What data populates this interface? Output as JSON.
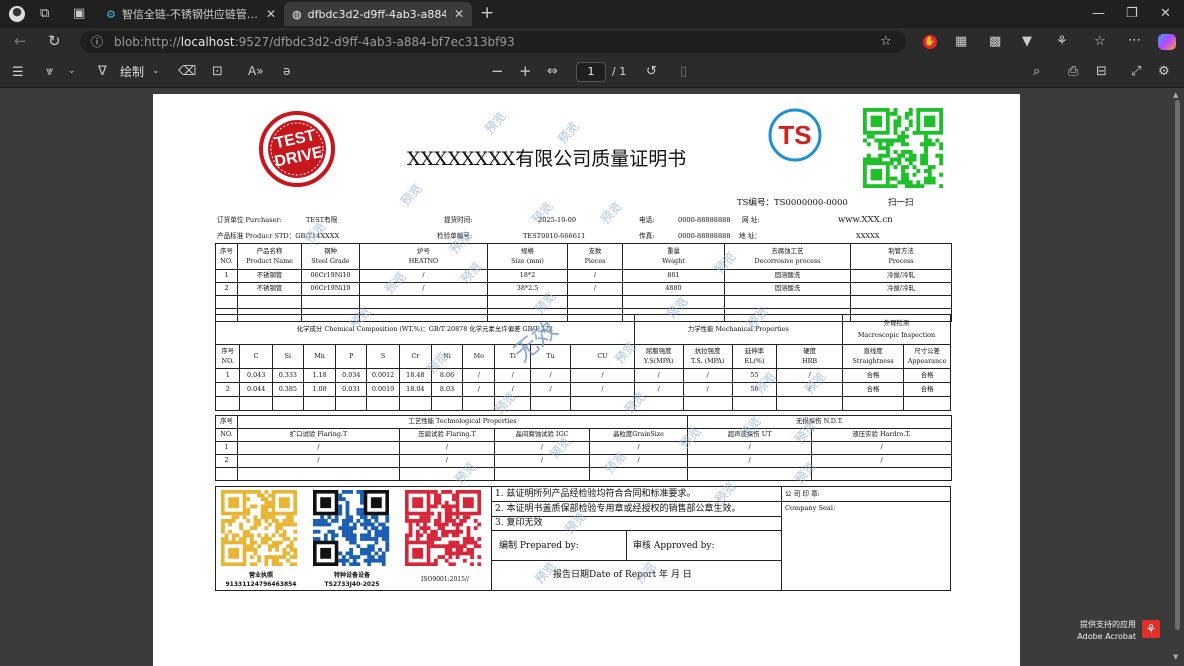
{
  "browser": {
    "tabs": [
      {
        "title": "智信全链-不锈钢供应链管理系统"
      },
      {
        "title": "dfbdc3d2-d9ff-4ab3-a884-bf7ec313bf93"
      }
    ],
    "url_prefix": "blob:http://",
    "url_host": "localhost",
    "url_rest": ":9527/dfbdc3d2-d9ff-4ab3-a884-bf7ec313bf93"
  },
  "pdf_toolbar": {
    "draw_label": "绘制",
    "page_current": "1",
    "page_total": "/ 1",
    "zoom_minus": "−",
    "zoom_plus": "+"
  },
  "acrobat": {
    "line1": "提供支持的应用",
    "line2": "Adobe Acrobat"
  },
  "certificate": {
    "stamp_text_1": "TEST",
    "stamp_text_2": "DRIVE",
    "ts_logo": "TS",
    "title": "XXXXXXXX有限公司质量证明书",
    "ts_no": "TS编号：TS0000000-0000",
    "scan": "扫一扫",
    "row1": {
      "buyer": "订货单位 Purchaser:",
      "buyer_val": "TEST有限",
      "ship": "提货时间:",
      "ship_val": "2025-10-09",
      "tel": "电话:",
      "tel_val": "0000-88888888",
      "web": "网  址:",
      "web_val": "www.XXX.cn"
    },
    "row2": {
      "std": "产品标准 Producr STD：GB/T14XXXX",
      "cert": "检验单编号:",
      "cert_val": "TEST0010-666611",
      "fax": "传真:",
      "fax_val": "0000-88888888",
      "addr": "地  址：",
      "addr_val": "XXXXX"
    },
    "main_head": [
      [
        "序号",
        "NO."
      ],
      [
        "产品名称",
        "Product Name"
      ],
      [
        "钢种",
        "Steel Grade"
      ],
      [
        "炉号",
        "HEATNO"
      ],
      [
        "规格",
        "Size (mm)"
      ],
      [
        "支数",
        "Pieces"
      ],
      [
        "重量",
        "Weight"
      ],
      [
        "去腐蚀工艺",
        "Decorrosive process"
      ],
      [
        "制管方法",
        "Process"
      ]
    ],
    "main_rows": [
      [
        "1",
        "不锈钢管",
        "06Cr19Ni10",
        "/",
        "18*2",
        "/",
        "801",
        "固溶酸洗",
        "冷拔/冷轧"
      ],
      [
        "2",
        "不锈钢管",
        "06Cr19Ni10",
        "/",
        "38*2.5",
        "/",
        "4880",
        "固溶酸洗",
        "冷拔/冷轧"
      ]
    ],
    "chem_title": "化学成分 Chemical Composition (WT.%)：GB/T 20878   化学元素允许偏差 GB/T 222",
    "mech_title": "力学性能 Mechanical Properties",
    "macro_title": "外观检测",
    "macro_sub": "Macroscopic Inspection",
    "chem_head": [
      [
        "序号",
        "NO."
      ],
      [
        "C",
        ""
      ],
      [
        "Si",
        ""
      ],
      [
        "Mn",
        ""
      ],
      [
        "P",
        ""
      ],
      [
        "S",
        ""
      ],
      [
        "Cr",
        ""
      ],
      [
        "Ni",
        ""
      ],
      [
        "Mo",
        ""
      ],
      [
        "Ti",
        ""
      ],
      [
        "Tu",
        ""
      ],
      [
        "CU",
        ""
      ],
      [
        "屈服强度",
        "Y.S(MPA)"
      ],
      [
        "抗拉强度",
        "T.S. (MPA)"
      ],
      [
        "延伸率",
        "EL(%)"
      ],
      [
        "硬度",
        "HRB"
      ],
      [
        "直线度",
        "Straightness"
      ],
      [
        "尺寸公差",
        "Appearance"
      ]
    ],
    "chem_rows": [
      [
        "1",
        "0.043",
        "0.333",
        "1.18",
        "0.034",
        "0.0012",
        "18.48",
        "8.06",
        "/",
        "/",
        "/",
        "/",
        "/",
        "/",
        "55",
        "/",
        "合格",
        "合格"
      ],
      [
        "2",
        "0.044",
        "0.385",
        "1.08",
        "0.031",
        "0.0019",
        "18.04",
        "8.03",
        "/",
        "/",
        "/",
        "/",
        "/",
        "/",
        "50",
        "/",
        "合格",
        "合格"
      ]
    ],
    "tech_no": "序号",
    "tech_title": "工艺性能 Technological Properties",
    "ndt_title": "无损探伤 N.D.T.",
    "tech_head": [
      "NO.",
      "扩口试验 Flaring.T",
      "压扁试验 Flaring.T",
      "晶间腐蚀试验 IGC",
      "晶粒度GrainSize",
      "超声波探伤 UT",
      "液压实验 Hardro.T."
    ],
    "tech_rows": [
      [
        "1",
        "/",
        "/",
        "/",
        "/",
        "/",
        "/"
      ],
      [
        "2",
        "/",
        "/",
        "/",
        "/",
        "/",
        "/"
      ]
    ],
    "qr_caps": [
      {
        "l1": "营业执照",
        "l2": "91331124796463854"
      },
      {
        "l1": "特种设备设备",
        "l2": "TS2733J40-2025"
      },
      {
        "l1": "ISO9001:2015//",
        "l2": ""
      }
    ],
    "notes": [
      "1. 兹证明所列产品经检验均符合合同和标准要求。",
      "2. 本证明书盖质保部检验专用章或经授权的销售部公章生效。",
      "3. 复印无效"
    ],
    "prepared": "编制 Prepared by:",
    "approved": "审核 Approved by:",
    "report_date": "报告日期Date of Report 年  月  日",
    "company_seal_cn": "公 司 印 章:",
    "company_seal_en": "Company Seal:",
    "watermark": "预览",
    "big_watermark": "无效"
  }
}
